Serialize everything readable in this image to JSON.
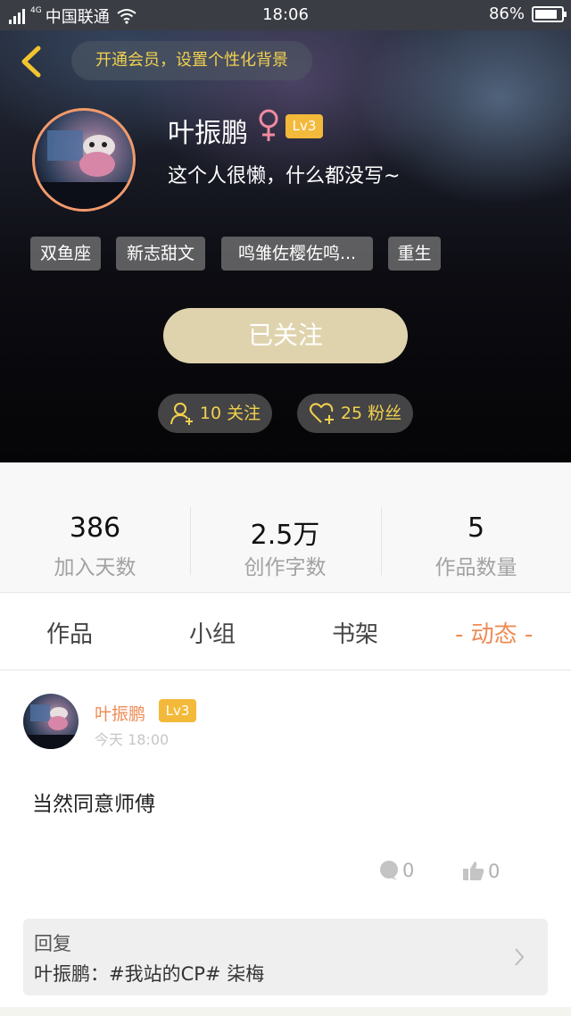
{
  "status_bar": {
    "network": "4G",
    "carrier": "中国联通",
    "time": "18:06",
    "battery_percent": "86%",
    "battery_level": 0.86
  },
  "header": {
    "vip_banner": "开通会员，设置个性化背景"
  },
  "profile": {
    "name": "叶振鹏",
    "level": "Lv3",
    "bio": "这个人很懒，什么都没写~",
    "tags": [
      "双鱼座",
      "新志甜文",
      "鸣雏佐樱佐鸣...",
      "重生"
    ],
    "follow_button": "已关注",
    "following": "10 关注",
    "fans": "25 粉丝"
  },
  "stats": [
    {
      "value": "386",
      "label": "加入天数"
    },
    {
      "value": "2.5万",
      "label": "创作字数"
    },
    {
      "value": "5",
      "label": "作品数量"
    }
  ],
  "tabs": [
    {
      "label": "作品"
    },
    {
      "label": "小组"
    },
    {
      "label": "书架"
    },
    {
      "label": "- 动态 -",
      "active": true
    }
  ],
  "post": {
    "author": "叶振鹏",
    "level": "Lv3",
    "time": "今天 18:00",
    "content": "当然同意师傅",
    "comments": "0",
    "likes": "0",
    "reply_title": "回复",
    "reply_text": "叶振鹏：#我站的CP# 柒梅"
  },
  "colors": {
    "accent_orange": "#ee8b55",
    "gold": "#f2d14d",
    "level_badge": "#f3b93a",
    "female_pink": "#f08aa0",
    "follow_button": "#dfd3ad"
  },
  "icons": [
    "back-arrow-icon",
    "female-icon",
    "add-user-icon",
    "heart-plus-icon",
    "comment-icon",
    "thumbs-up-icon",
    "chevron-right-icon",
    "wifi-icon",
    "signal-icon",
    "battery-icon"
  ]
}
